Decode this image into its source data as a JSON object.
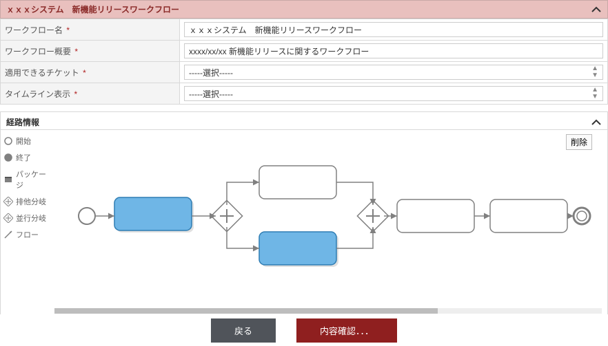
{
  "header": {
    "title": "ｘｘｘシステム　新機能リリースワークフロー"
  },
  "form": {
    "rows": [
      {
        "label": "ワークフロー名",
        "required": true,
        "type": "input",
        "value": "ｘｘｘシステム　新機能リリースワークフロー"
      },
      {
        "label": "ワークフロー概要",
        "required": true,
        "type": "input",
        "value": "xxxx/xx/xx 新機能リリースに関するワークフロー"
      },
      {
        "label": "適用できるチケット",
        "required": true,
        "type": "select",
        "value": "-----選択-----"
      },
      {
        "label": "タイムライン表示",
        "required": true,
        "type": "select",
        "value": "-----選択-----"
      }
    ]
  },
  "routeSection": {
    "title": "経路情報",
    "delete": "削除",
    "palette": [
      {
        "key": "start",
        "label": "開始"
      },
      {
        "key": "end",
        "label": "終了"
      },
      {
        "key": "package",
        "label": "パッケージ"
      },
      {
        "key": "parallel",
        "label": "排他分岐"
      },
      {
        "key": "inclusive",
        "label": "並行分岐"
      },
      {
        "key": "flow",
        "label": "フロー"
      }
    ]
  },
  "footer": {
    "back": "戻る",
    "confirm": "内容確認．．．"
  }
}
